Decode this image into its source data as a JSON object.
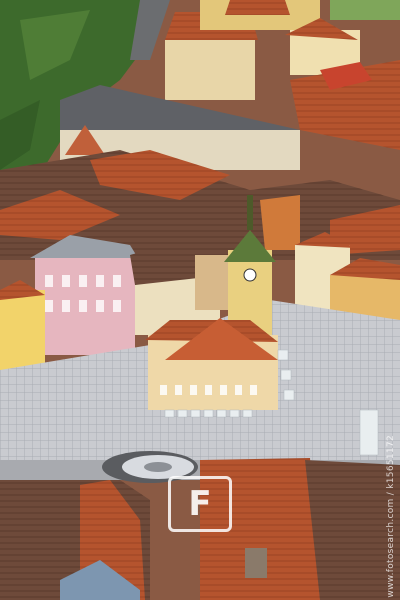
{
  "image": {
    "watermark_text": "",
    "watermark_letter": "F",
    "photo_id_text": "www.fotosearch.com / k15651172",
    "scene_subject": "aerial-view-of-old-town-square",
    "colors": {
      "roof_terracotta": "#b5542e",
      "roof_dark": "#6e4a3a",
      "facade_cream": "#e8d6a8",
      "facade_pink": "#e6b6bf",
      "square_paving": "#c9cbd0",
      "tower_green": "#5c7a3a",
      "trees": "#3d6a2c"
    }
  }
}
